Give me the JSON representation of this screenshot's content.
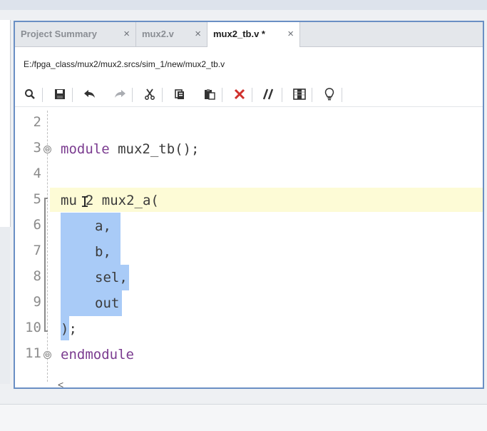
{
  "tabs": [
    {
      "label": "Project Summary",
      "close": "×"
    },
    {
      "label": "mux2.v",
      "close": "×"
    },
    {
      "label": "mux2_tb.v *",
      "close": "×"
    }
  ],
  "file_path": "E:/fpga_class/mux2/mux2.srcs/sim_1/new/mux2_tb.v",
  "toolbar": [
    "search-icon",
    "save-icon",
    "undo-icon",
    "redo-icon",
    "cut-icon",
    "copy-icon",
    "paste-icon",
    "delete-icon",
    "comment-icon",
    "columns-icon",
    "lightbulb-icon"
  ],
  "line_numbers": [
    "2",
    "3",
    "4",
    "5",
    "6",
    "7",
    "8",
    "9",
    "10",
    "11"
  ],
  "code": {
    "l3_kw": "module",
    "l3_rest": " mux2_tb();",
    "l5_a": "mu",
    "l5_b": "2 mux2_a(",
    "l6": "a,",
    "l7": "b,",
    "l8": "sel,",
    "l9": "out",
    "l10": ");",
    "l11_kw": "endmodule"
  },
  "scroll_left": "<",
  "colors": {
    "keyword": "#7b3c90",
    "selection": "#a9cbf7",
    "current_line": "#fdfbd6",
    "editor_border": "#6a8fc4"
  }
}
